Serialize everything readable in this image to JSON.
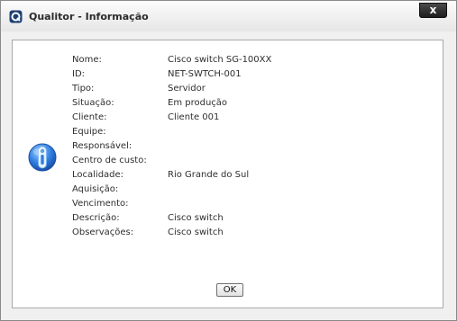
{
  "window": {
    "title": "Qualitor - Informação",
    "close_label": "x",
    "app_icon": "qualitor-logo-icon",
    "info_icon": "info-icon"
  },
  "fields": [
    {
      "label": "Nome:",
      "value": "Cisco switch SG-100XX"
    },
    {
      "label": "ID:",
      "value": "NET-SWTCH-001"
    },
    {
      "label": "Tipo:",
      "value": "Servidor"
    },
    {
      "label": "Situação:",
      "value": "Em produção"
    },
    {
      "label": "Cliente:",
      "value": "Cliente 001"
    },
    {
      "label": "Equipe:",
      "value": ""
    },
    {
      "label": "Responsável:",
      "value": ""
    },
    {
      "label": "Centro de custo:",
      "value": ""
    },
    {
      "label": "Localidade:",
      "value": "Rio Grande do Sul"
    },
    {
      "label": "Aquisição:",
      "value": ""
    },
    {
      "label": "Vencimento:",
      "value": ""
    },
    {
      "label": "Descrição:",
      "value": "Cisco switch"
    },
    {
      "label": "Observações:",
      "value": "Cisco switch"
    }
  ],
  "buttons": {
    "ok_label": "OK"
  }
}
